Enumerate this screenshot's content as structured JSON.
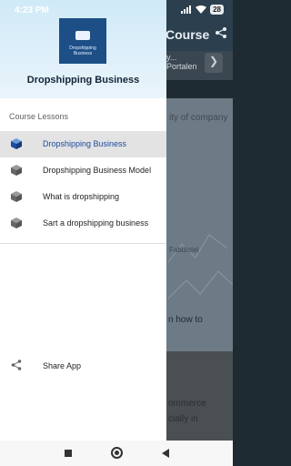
{
  "status": {
    "time": "4:23 PM",
    "battery": "28"
  },
  "background": {
    "app_title": "Course",
    "ad_line1": "y...",
    "ad_line2": "Portalen",
    "photo_caption1": "ity of company",
    "photo_caption2": "Fabdistel",
    "photo_caption3": "n how to",
    "body_line1": "ommerce",
    "body_line2": "cially in"
  },
  "drawer": {
    "logo_text": "Dropshipping Business",
    "title": "Dropshipping Business",
    "section_label": "Course Lessons",
    "items": [
      {
        "label": "Dropshipping Business",
        "icon": "cube-icon",
        "active": true
      },
      {
        "label": "Dropshipping Business Model",
        "icon": "cube-icon",
        "active": false
      },
      {
        "label": "What is dropshipping",
        "icon": "cube-icon",
        "active": false
      },
      {
        "label": "Sart a dropshipping business",
        "icon": "cube-icon",
        "active": false
      }
    ],
    "share_label": "Share App"
  },
  "colors": {
    "accent": "#1e4ba0",
    "header_bg": "#d0eaf8",
    "logo_bg": "#1d4f86"
  }
}
